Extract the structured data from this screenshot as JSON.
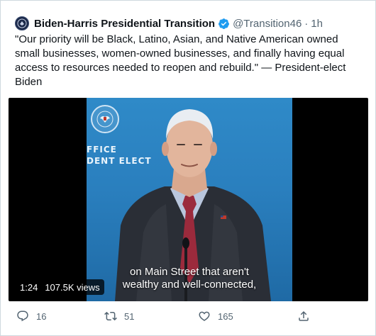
{
  "account": {
    "name": "Biden-Harris Presidential Transition",
    "handle": "@Transition46",
    "separator": "·",
    "time": "1h"
  },
  "tweet": {
    "text": "\"Our priority will be Black, Latino, Asian, and Native American owned small businesses, women-owned businesses, and finally having equal access to resources needed to reopen and rebuild.\" — President-elect Biden"
  },
  "video": {
    "podium_line1": "FFICE",
    "podium_line2": "DENT ELECT",
    "caption_line1": "on Main Street that aren't",
    "caption_line2": "wealthy and well-connected,",
    "duration": "1:24",
    "views": "107.5K views"
  },
  "actions": {
    "replies": "16",
    "retweets": "51",
    "likes": "165"
  },
  "icons": {
    "verified": "verified-badge-icon",
    "reply": "reply-icon",
    "retweet": "retweet-icon",
    "like": "heart-icon",
    "share": "share-icon"
  },
  "colors": {
    "verified": "#1d9bf0",
    "secondary_text": "#536471",
    "border": "#cfd9de"
  }
}
